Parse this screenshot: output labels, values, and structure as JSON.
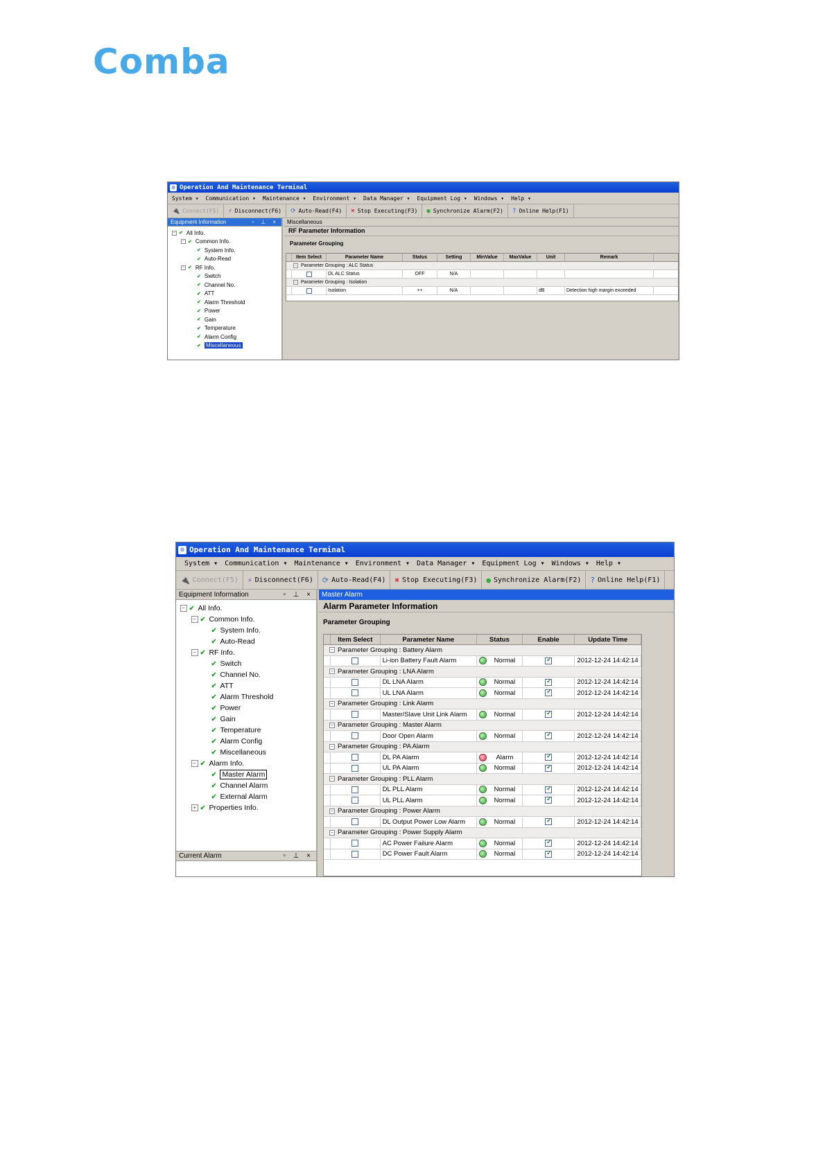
{
  "logo": {
    "text": "Comba"
  },
  "win1": {
    "title": "Operation And Maintenance Terminal",
    "menu": [
      "System ▾",
      "Communication ▾",
      "Maintenance ▾",
      "Environment ▾",
      "Data Manager ▾",
      "Equipment Log ▾",
      "Windows ▾",
      "Help ▾"
    ],
    "toolbar": [
      "Connect(F5)",
      "Disconnect(F6)",
      "Auto-Read(F4)",
      "Stop Executing(F3)",
      "Synchronize Alarm(F2)",
      "Online Help(F1)"
    ],
    "left_title": "Equipment Information",
    "tree": [
      "All Info.",
      "Common Info.",
      "System Info.",
      "Auto-Read",
      "RF Info.",
      "Switch",
      "Channel No.",
      "ATT",
      "Alarm Threshold",
      "Power",
      "Gain",
      "Temperature",
      "Alarm Config",
      "Miscellaneous"
    ],
    "tab": "Miscellaneous",
    "section": "RF Parameter Information",
    "grouping": "Parameter Grouping",
    "columns": [
      "Item Select",
      "Parameter Name",
      "Status",
      "Setting",
      "MinValue",
      "MaxValue",
      "Unit",
      "Remark"
    ],
    "groups": [
      {
        "label": "Parameter Grouping : ALC Status",
        "rows": [
          {
            "name": "DL ALC Status",
            "status": "OFF",
            "setting": "N/A",
            "min": "",
            "max": "",
            "unit": "",
            "remark": ""
          }
        ]
      },
      {
        "label": "Parameter Grouping : Isolation",
        "rows": [
          {
            "name": "Isolation",
            "status": "++",
            "setting": "N/A",
            "min": "",
            "max": "",
            "unit": "dB",
            "remark": "Detection high margin exceeded"
          }
        ]
      }
    ]
  },
  "win2": {
    "title": "Operation And Maintenance Terminal",
    "menu": [
      "System ▾",
      "Communication ▾",
      "Maintenance ▾",
      "Environment ▾",
      "Data Manager ▾",
      "Equipment Log ▾",
      "Windows ▾",
      "Help ▾"
    ],
    "toolbar": [
      "Connect(F5)",
      "Disconnect(F6)",
      "Auto-Read(F4)",
      "Stop Executing(F3)",
      "Synchronize Alarm(F2)",
      "Online Help(F1)"
    ],
    "left_title": "Equipment Information",
    "tree": [
      "All Info.",
      "Common Info.",
      "System Info.",
      "Auto-Read",
      "RF Info.",
      "Switch",
      "Channel No.",
      "ATT",
      "Alarm Threshold",
      "Power",
      "Gain",
      "Temperature",
      "Alarm Config",
      "Miscellaneous",
      "Alarm Info.",
      "Master Alarm",
      "Channel Alarm",
      "External Alarm",
      "Properties Info."
    ],
    "bottom_pane": "Current Alarm",
    "tab": "Master Alarm",
    "section": "Alarm Parameter Information",
    "grouping": "Parameter Grouping",
    "columns": [
      "Item Select",
      "Parameter Name",
      "Status",
      "Enable",
      "Update Time"
    ],
    "groups": [
      {
        "label": "Parameter Grouping : Battery Alarm",
        "rows": [
          {
            "name": "Li-ion Battery Fault Alarm",
            "status": "Normal",
            "led": "green",
            "time": "2012-12-24 14:42:14"
          }
        ]
      },
      {
        "label": "Parameter Grouping : LNA Alarm",
        "rows": [
          {
            "name": "DL LNA Alarm",
            "status": "Normal",
            "led": "green",
            "time": "2012-12-24 14:42:14"
          },
          {
            "name": "UL LNA Alarm",
            "status": "Normal",
            "led": "green",
            "time": "2012-12-24 14:42:14"
          }
        ]
      },
      {
        "label": "Parameter Grouping : Link Alarm",
        "rows": [
          {
            "name": "Master/Slave Unit Link Alarm",
            "status": "Normal",
            "led": "green",
            "time": "2012-12-24 14:42:14"
          }
        ]
      },
      {
        "label": "Parameter Grouping : Master Alarm",
        "rows": [
          {
            "name": "Door Open Alarm",
            "status": "Normal",
            "led": "green",
            "time": "2012-12-24 14:42:14"
          }
        ]
      },
      {
        "label": "Parameter Grouping : PA Alarm",
        "rows": [
          {
            "name": "DL PA Alarm",
            "status": "Alarm",
            "led": "red",
            "time": "2012-12-24 14:42:14"
          },
          {
            "name": "UL PA Alarm",
            "status": "Normal",
            "led": "green",
            "time": "2012-12-24 14:42:14"
          }
        ]
      },
      {
        "label": "Parameter Grouping : PLL Alarm",
        "rows": [
          {
            "name": "DL PLL Alarm",
            "status": "Normal",
            "led": "green",
            "time": "2012-12-24 14:42:14"
          },
          {
            "name": "UL PLL Alarm",
            "status": "Normal",
            "led": "green",
            "time": "2012-12-24 14:42:14"
          }
        ]
      },
      {
        "label": "Parameter Grouping : Power Alarm",
        "rows": [
          {
            "name": "DL Output Power Low Alarm",
            "status": "Normal",
            "led": "green",
            "time": "2012-12-24 14:42:14"
          }
        ]
      },
      {
        "label": "Parameter Grouping : Power Supply Alarm",
        "rows": [
          {
            "name": "AC Power Failure Alarm",
            "status": "Normal",
            "led": "green",
            "time": "2012-12-24 14:42:14"
          },
          {
            "name": "DC Power Fault Alarm",
            "status": "Normal",
            "led": "green",
            "time": "2012-12-24 14:42:14"
          }
        ]
      }
    ]
  }
}
